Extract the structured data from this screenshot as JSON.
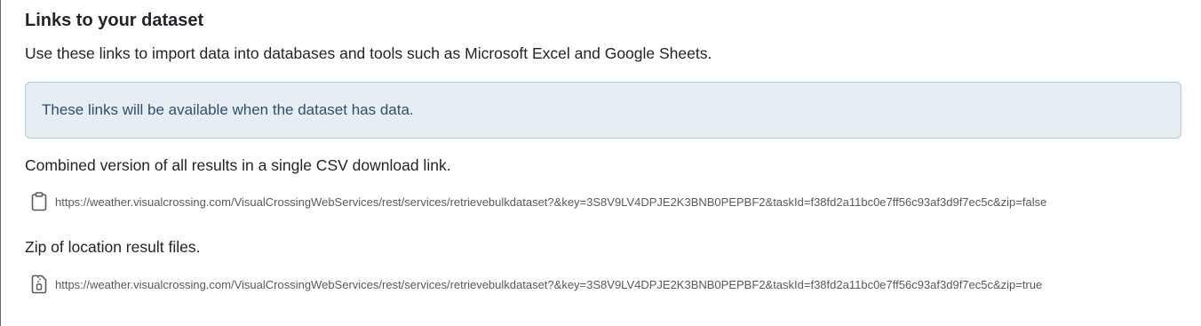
{
  "section": {
    "title": "Links to your dataset",
    "description": "Use these links to import data into databases and tools such as Microsoft Excel and Google Sheets."
  },
  "alert": {
    "message": "These links will be available when the dataset has data."
  },
  "links": [
    {
      "label": "Combined version of all results in a single CSV download link.",
      "icon": "clipboard-icon",
      "url": "https://weather.visualcrossing.com/VisualCrossingWebServices/rest/services/retrievebulkdataset?&key=3S8V9LV4DPJE2K3BNB0PEPBF2&taskId=f38fd2a11bc0e7ff56c93af3d9f7ec5c&zip=false"
    },
    {
      "label": "Zip of location result files.",
      "icon": "zip-file-icon",
      "url": "https://weather.visualcrossing.com/VisualCrossingWebServices/rest/services/retrievebulkdataset?&key=3S8V9LV4DPJE2K3BNB0PEPBF2&taskId=f38fd2a11bc0e7ff56c93af3d9f7ec5c&zip=true"
    }
  ],
  "colors": {
    "alert_background": "#e7eef3",
    "alert_border": "#b6cdd8",
    "alert_text": "#2e4f6e",
    "url_text": "#555b61"
  }
}
